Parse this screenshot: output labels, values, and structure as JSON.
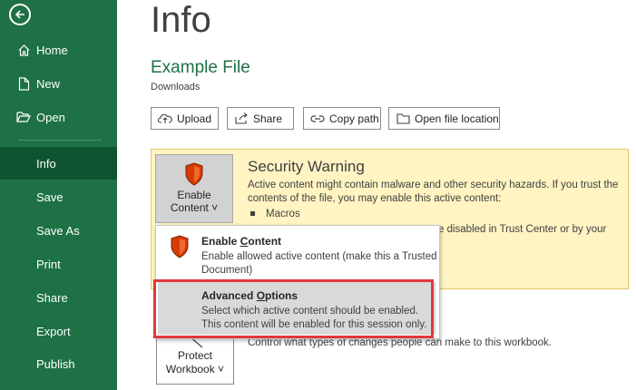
{
  "page": {
    "title": "Info",
    "file_name": "Example File",
    "location": "Downloads"
  },
  "sidebar": {
    "back_icon": "back-arrow-icon",
    "items": [
      {
        "label": "Home",
        "icon": "home-icon"
      },
      {
        "label": "New",
        "icon": "new-document-icon"
      },
      {
        "label": "Open",
        "icon": "folder-open-icon"
      },
      {
        "label": "Info"
      },
      {
        "label": "Save"
      },
      {
        "label": "Save As"
      },
      {
        "label": "Print"
      },
      {
        "label": "Share"
      },
      {
        "label": "Export"
      },
      {
        "label": "Publish"
      }
    ],
    "active": "Info"
  },
  "actions": {
    "upload": "Upload",
    "share": "Share",
    "copy_path": "Copy path",
    "open_location": "Open file location"
  },
  "security": {
    "button_line1": "Enable",
    "button_line2": "Content ˅",
    "title": "Security Warning",
    "description": "Active content might contain malware and other security hazards. If you trust the contents of the file, you may enable this active content:",
    "bullet": "Macros",
    "more_text": "e disabled in Trust Center or by your"
  },
  "dropdown": {
    "enable_content": {
      "title_pre": "Enable ",
      "title_u": "C",
      "title_post": "ontent",
      "description": "Enable allowed active content (make this a Trusted Document)"
    },
    "advanced_options": {
      "title_pre": "Advanced ",
      "title_u": "O",
      "title_post": "ptions",
      "description": "Select which active content should be enabled. This content will be enabled for this session only."
    }
  },
  "protect": {
    "button_line1": "Protect",
    "button_line2": "Workbook ˅",
    "description": "Control what types of changes people can make to this workbook."
  },
  "colors": {
    "brand": "#1e7145",
    "warning_bg": "#fff4c2",
    "highlight": "#e0393b",
    "shield": "#d83b01"
  }
}
